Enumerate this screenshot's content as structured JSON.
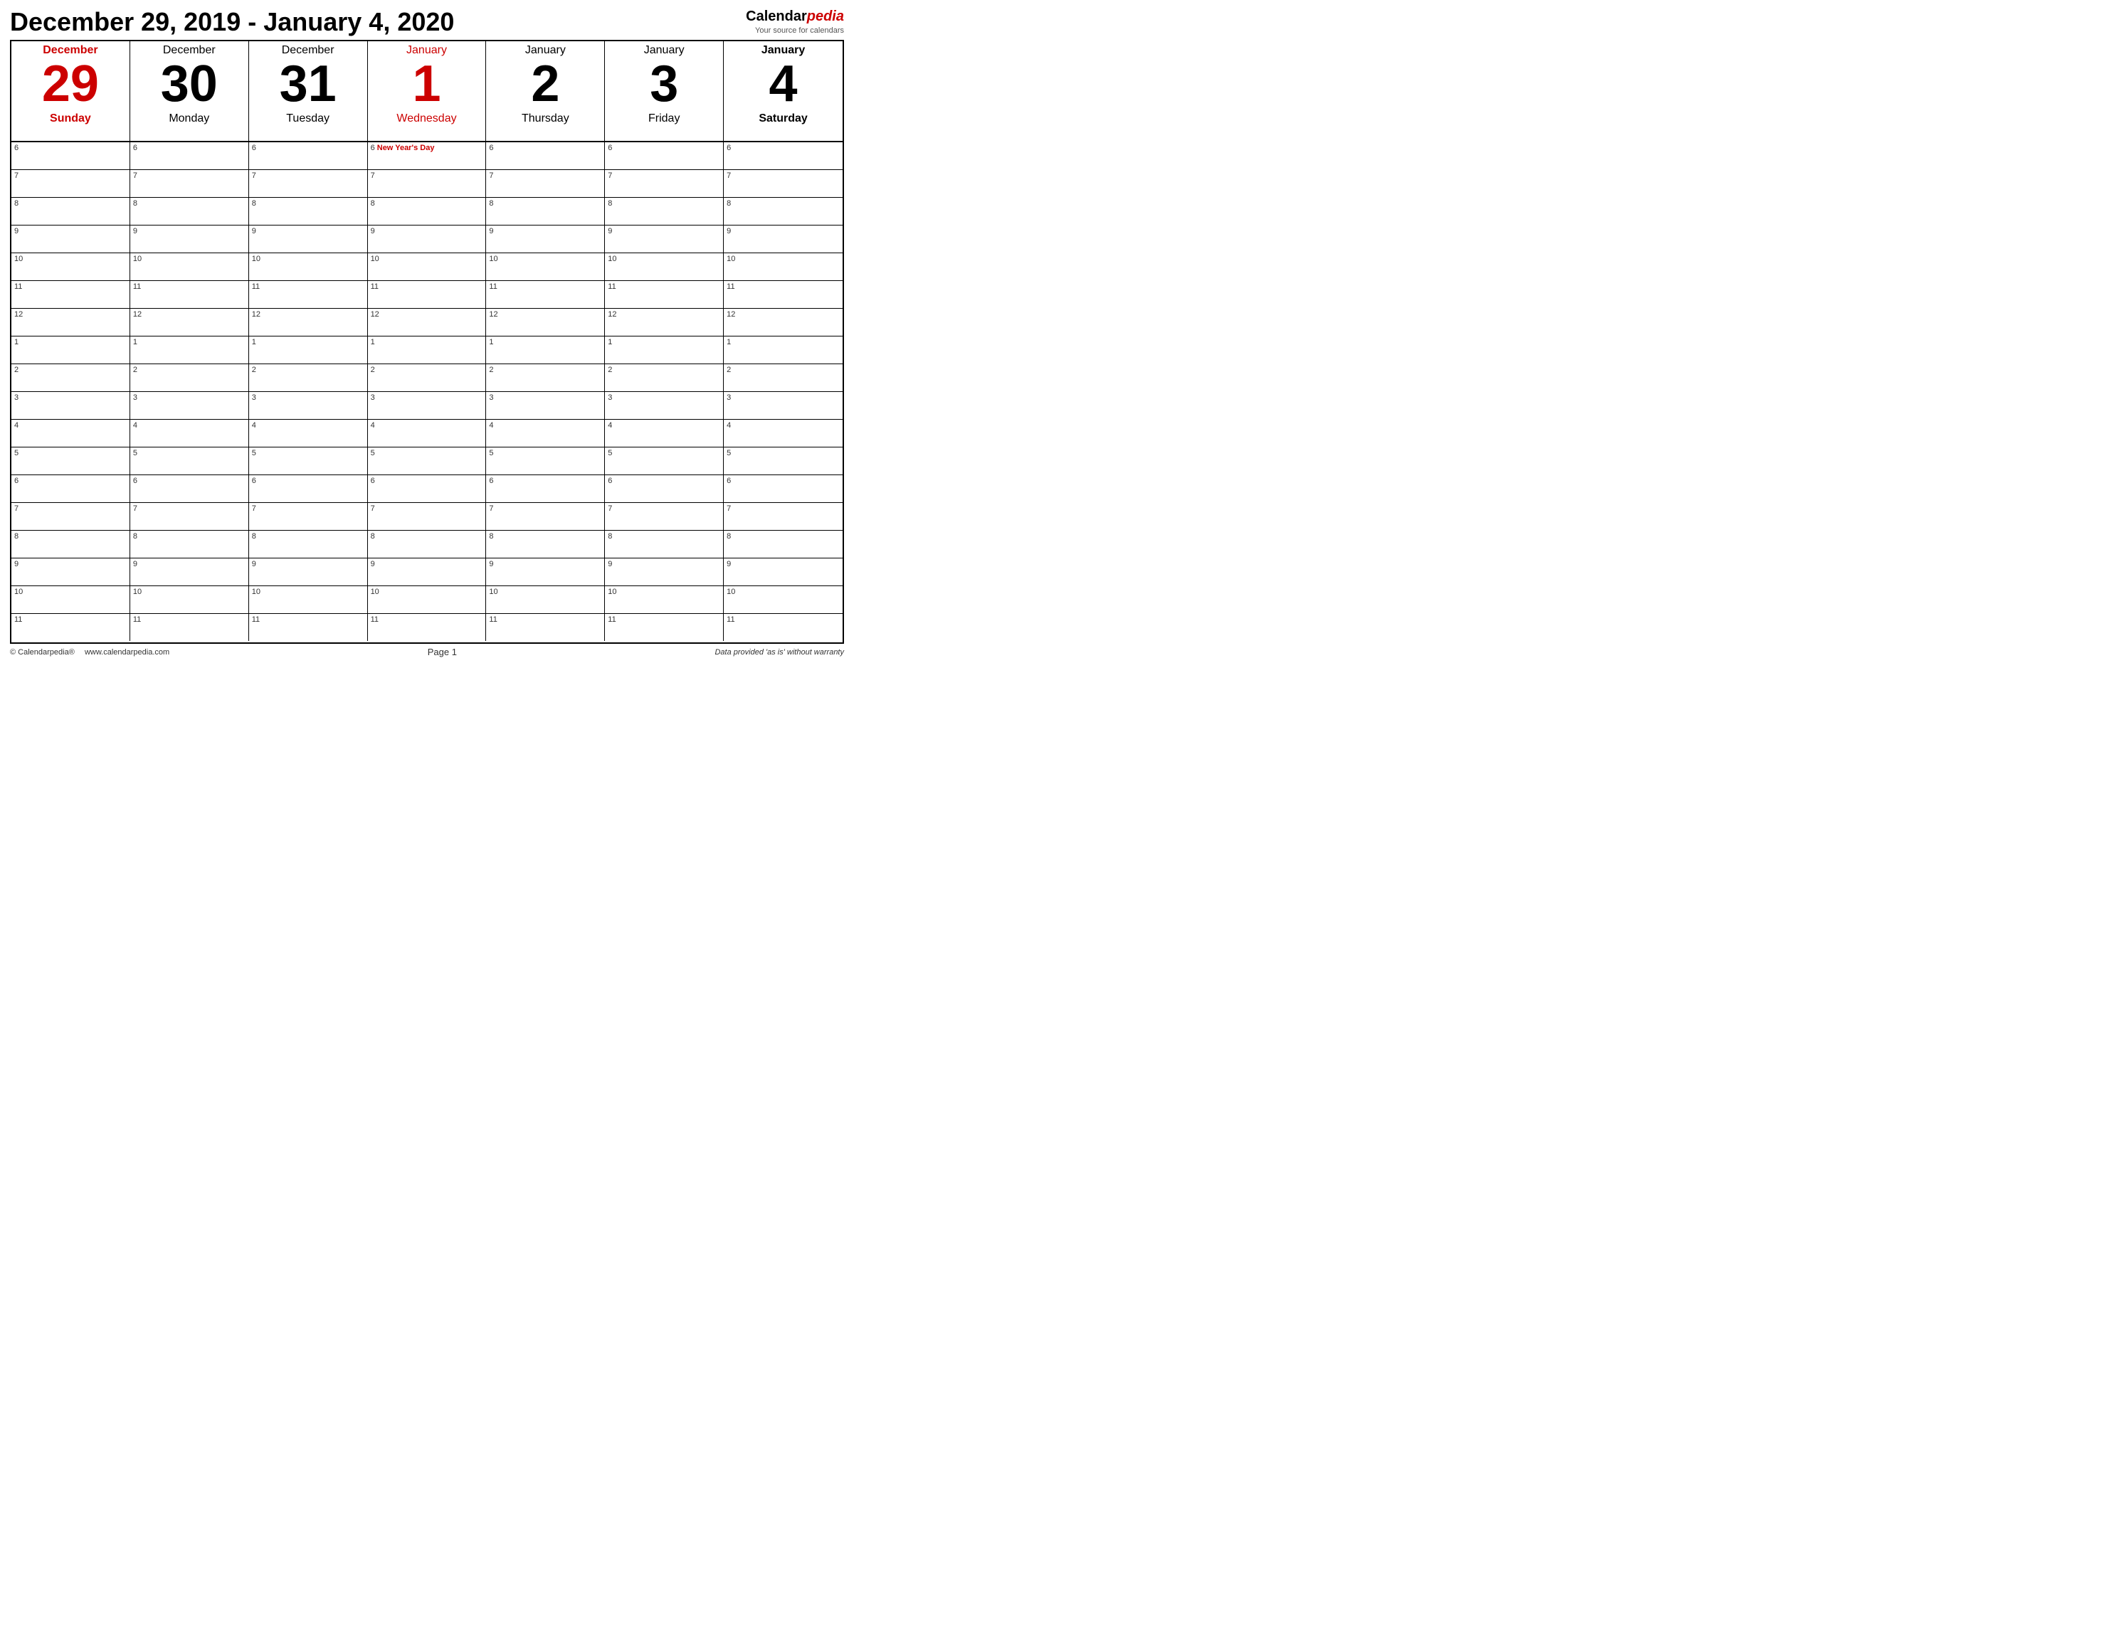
{
  "header": {
    "title": "December 29, 2019 - January 4, 2020",
    "logo": {
      "brand": "Calendar",
      "brand_italic": "pedia",
      "tagline": "Your source for calendars"
    }
  },
  "days": [
    {
      "id": "dec29",
      "month": "December",
      "number": "29",
      "name": "Sunday",
      "type": "sunday",
      "highlight": false
    },
    {
      "id": "dec30",
      "month": "December",
      "number": "30",
      "name": "Monday",
      "type": "normal",
      "highlight": false
    },
    {
      "id": "dec31",
      "month": "December",
      "number": "31",
      "name": "Tuesday",
      "type": "normal",
      "highlight": false
    },
    {
      "id": "jan1",
      "month": "January",
      "number": "1",
      "name": "Wednesday",
      "type": "highlight",
      "highlight": true
    },
    {
      "id": "jan2",
      "month": "January",
      "number": "2",
      "name": "Thursday",
      "type": "normal",
      "highlight": false
    },
    {
      "id": "jan3",
      "month": "January",
      "number": "3",
      "name": "Friday",
      "type": "normal",
      "highlight": false
    },
    {
      "id": "jan4",
      "month": "January",
      "number": "4",
      "name": "Saturday",
      "type": "saturday",
      "highlight": false
    }
  ],
  "time_slots": [
    {
      "hour": "6",
      "holiday_col": 3,
      "holiday_text": "New Year's Day"
    },
    {
      "hour": "7",
      "holiday_col": -1,
      "holiday_text": ""
    },
    {
      "hour": "8",
      "holiday_col": -1,
      "holiday_text": ""
    },
    {
      "hour": "9",
      "holiday_col": -1,
      "holiday_text": ""
    },
    {
      "hour": "10",
      "holiday_col": -1,
      "holiday_text": ""
    },
    {
      "hour": "11",
      "holiday_col": -1,
      "holiday_text": ""
    },
    {
      "hour": "12",
      "holiday_col": -1,
      "holiday_text": ""
    },
    {
      "hour": "1",
      "holiday_col": -1,
      "holiday_text": ""
    },
    {
      "hour": "2",
      "holiday_col": -1,
      "holiday_text": ""
    },
    {
      "hour": "3",
      "holiday_col": -1,
      "holiday_text": ""
    },
    {
      "hour": "4",
      "holiday_col": -1,
      "holiday_text": ""
    },
    {
      "hour": "5",
      "holiday_col": -1,
      "holiday_text": ""
    },
    {
      "hour": "6",
      "holiday_col": -1,
      "holiday_text": ""
    },
    {
      "hour": "7",
      "holiday_col": -1,
      "holiday_text": ""
    },
    {
      "hour": "8",
      "holiday_col": -1,
      "holiday_text": ""
    },
    {
      "hour": "9",
      "holiday_col": -1,
      "holiday_text": ""
    },
    {
      "hour": "10",
      "holiday_col": -1,
      "holiday_text": ""
    },
    {
      "hour": "11",
      "holiday_col": -1,
      "holiday_text": ""
    }
  ],
  "footer": {
    "copyright": "© Calendarpedia®",
    "website": "www.calendarpedia.com",
    "page": "Page 1",
    "disclaimer": "Data provided 'as is' without warranty"
  }
}
